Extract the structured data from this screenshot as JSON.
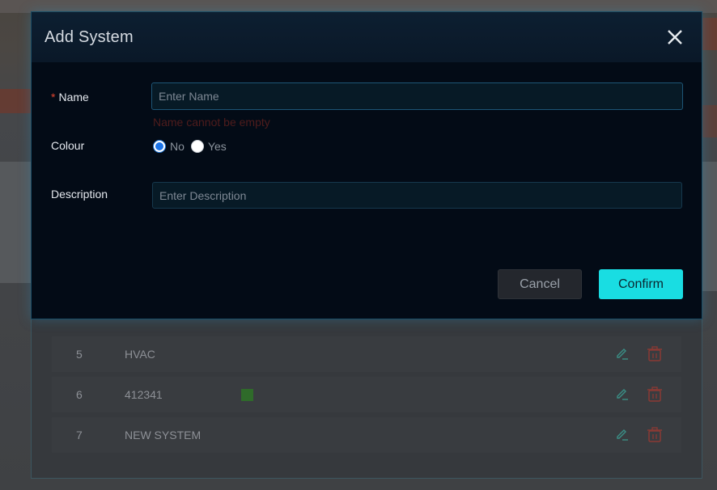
{
  "modal": {
    "title": "Add System",
    "fields": {
      "name": {
        "required_mark": "*",
        "label": "Name",
        "placeholder": "Enter Name",
        "value": "",
        "error": "Name cannot be empty"
      },
      "colour": {
        "label": "Colour",
        "options": [
          "No",
          "Yes"
        ],
        "selected": "No"
      },
      "description": {
        "label": "Description",
        "placeholder": "Enter Description",
        "value": ""
      }
    },
    "buttons": {
      "cancel": "Cancel",
      "confirm": "Confirm"
    }
  },
  "table": {
    "rows": [
      {
        "no": "5",
        "name": "HVAC",
        "has_colour": false
      },
      {
        "no": "6",
        "name": "412341",
        "has_colour": true,
        "colour": "#2f6b2a"
      },
      {
        "no": "7",
        "name": "NEW SYSTEM",
        "has_colour": false
      }
    ]
  },
  "colors": {
    "accent": "#19dde2",
    "error": "#4f1c1c",
    "required": "#e0452f",
    "edit_icon": "#3a8f86",
    "delete_icon": "#8a3a34"
  },
  "icons": {
    "close": "close-icon",
    "edit": "edit-icon",
    "delete": "trash-icon"
  }
}
